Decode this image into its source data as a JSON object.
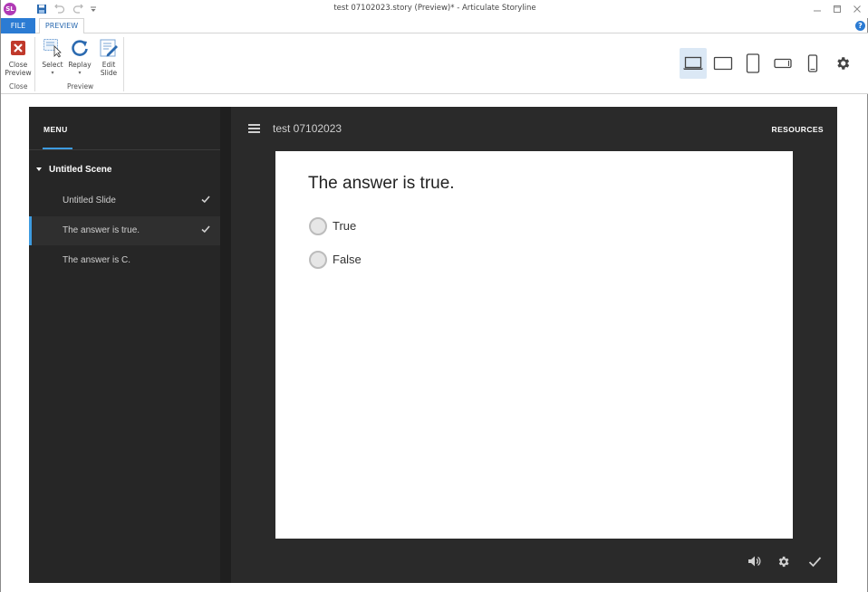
{
  "window": {
    "app_icon_text": "SL",
    "title": "test 07102023.story (Preview)* - Articulate Storyline"
  },
  "ribbon": {
    "tabs": [
      {
        "label": "FILE"
      },
      {
        "label": "PREVIEW"
      }
    ],
    "help": "?",
    "buttons": {
      "close_preview": "Close\nPreview",
      "select": "Select",
      "replay": "Replay",
      "edit_slide": "Edit\nSlide"
    },
    "groups": {
      "close": "Close",
      "preview": "Preview"
    }
  },
  "player": {
    "menu_label": "MENU",
    "course_title": "test 07102023",
    "resources_label": "RESOURCES",
    "scene": "Untitled Scene",
    "slides": [
      {
        "label": "Untitled Slide",
        "visited": true
      },
      {
        "label": "The answer is true.",
        "visited": true
      },
      {
        "label": "The answer is C.",
        "visited": false
      }
    ]
  },
  "slide": {
    "question": "The answer is true.",
    "choices": [
      {
        "label": "True"
      },
      {
        "label": "False"
      }
    ]
  },
  "colors": {
    "accent": "#3d9be0",
    "file_tab": "#2b7bd3",
    "player_bg": "#2a2a2a",
    "close_icon": "#c0392b"
  }
}
